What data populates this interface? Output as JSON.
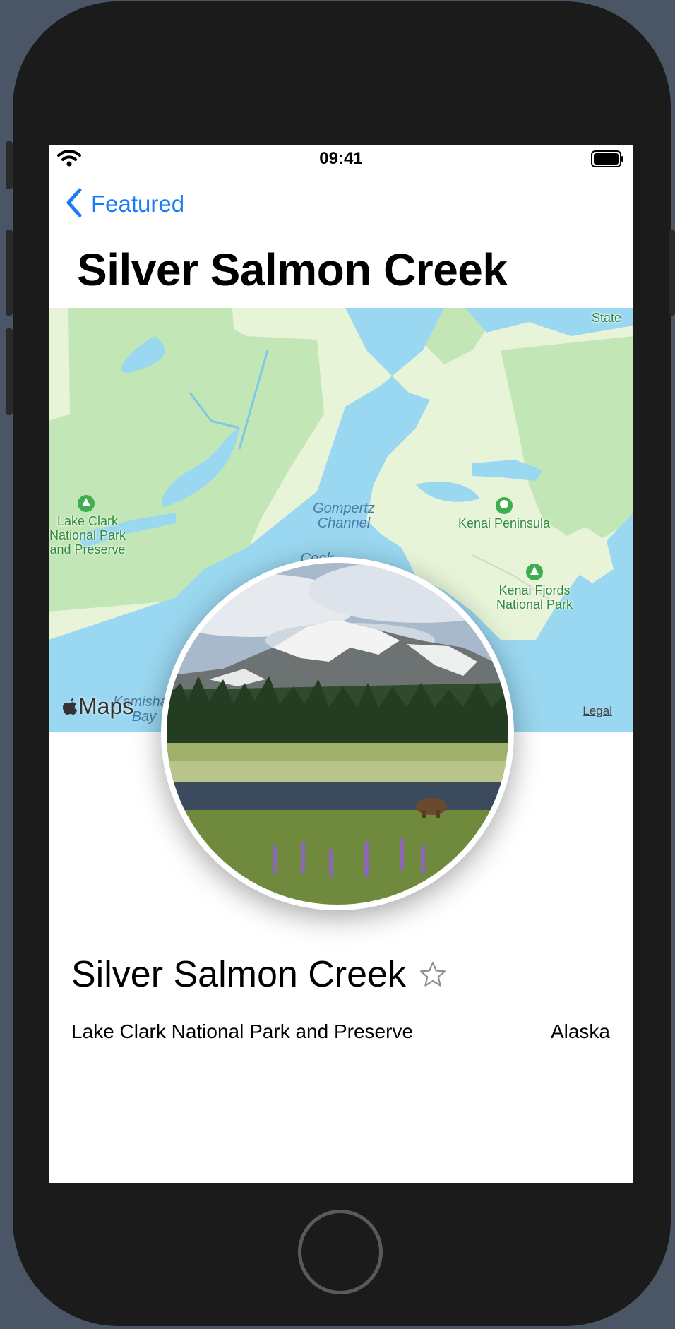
{
  "status_bar": {
    "time": "09:41",
    "wifi_icon": "wifi-icon",
    "battery_icon": "battery-icon"
  },
  "nav": {
    "back_label": "Featured",
    "back_icon": "chevron-left-icon",
    "title": "Silver Salmon Creek"
  },
  "map": {
    "labels": {
      "lake_clark": "Lake Clark\nNational Park\nand Preserve",
      "kenai_peninsula": "Kenai Peninsula",
      "kenai_fjords": "Kenai Fjords\nNational Park",
      "state": "State",
      "gompertz": "Gompertz\nChannel",
      "cook": "Cook",
      "kamishak": "Kamishak\nBay"
    },
    "attribution": "Maps",
    "legal": "Legal"
  },
  "landmark": {
    "name": "Silver Salmon Creek",
    "park": "Lake Clark National Park and Preserve",
    "state": "Alaska",
    "favorite_icon": "star-outline-icon"
  },
  "colors": {
    "accent": "#1a7cf5",
    "water": "#9ad7f0",
    "park_green": "#c2e6b5",
    "land": "#e7f4d8"
  }
}
